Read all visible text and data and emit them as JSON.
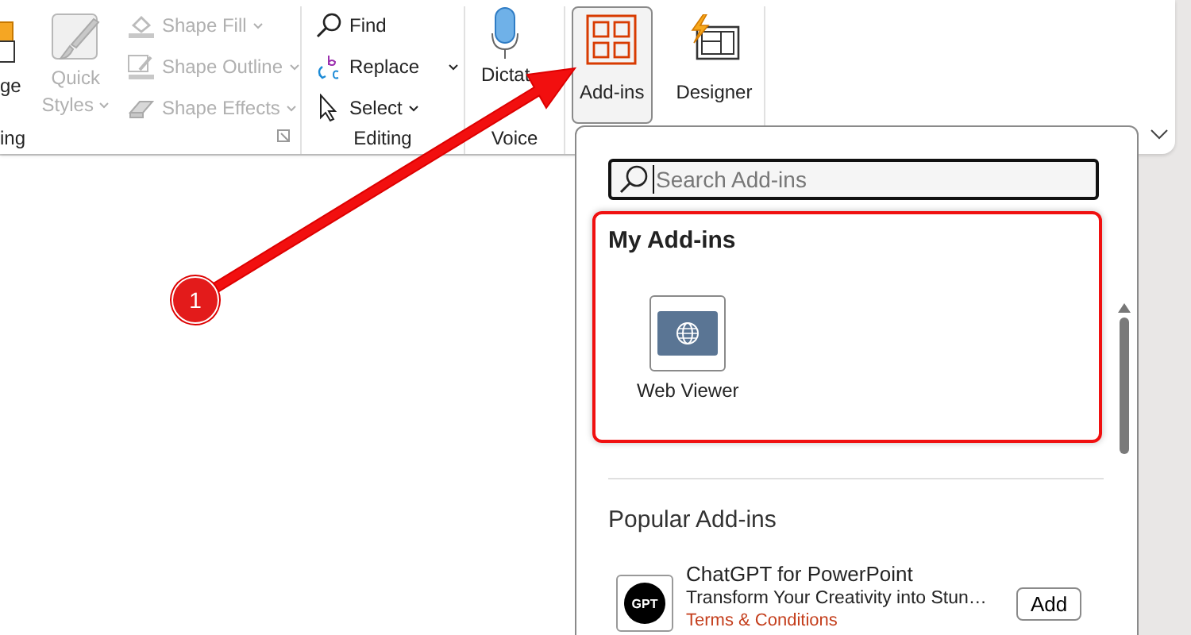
{
  "ribbon": {
    "arrange": {
      "label": "ge"
    },
    "quick_styles": {
      "line1": "Quick",
      "line2": "Styles",
      "disabled": true
    },
    "shape_commands": [
      {
        "kind": "fill",
        "label": "Shape Fill",
        "disabled": true
      },
      {
        "kind": "outline",
        "label": "Shape Outline",
        "disabled": true
      },
      {
        "kind": "effects",
        "label": "Shape Effects",
        "disabled": true
      }
    ],
    "drawing_label": "ing",
    "editing": {
      "label": "Editing",
      "commands": [
        {
          "kind": "find",
          "label": "Find",
          "menu": false
        },
        {
          "kind": "replace",
          "label": "Replace",
          "menu": true
        },
        {
          "kind": "select",
          "label": "Select",
          "menu": true
        }
      ]
    },
    "voice": {
      "label": "Voice",
      "command": "Dictat"
    },
    "addins_button": {
      "label": "Add-ins",
      "selected": true
    },
    "designer_button": {
      "label": "Designer",
      "selected": false
    }
  },
  "panel": {
    "search": {
      "placeholder": "Search Add-ins"
    },
    "my_addins": {
      "title": "My Add-ins",
      "highlighted": true,
      "items": [
        {
          "name": "Web Viewer"
        }
      ]
    },
    "popular": {
      "title": "Popular Add-ins",
      "items": [
        {
          "name": "ChatGPT for PowerPoint",
          "logo_text": "GPT",
          "description": "Transform Your Creativity into Stun…",
          "button": "Add",
          "link": "Terms & Conditions"
        }
      ]
    }
  },
  "annotation": {
    "callout": "1"
  }
}
